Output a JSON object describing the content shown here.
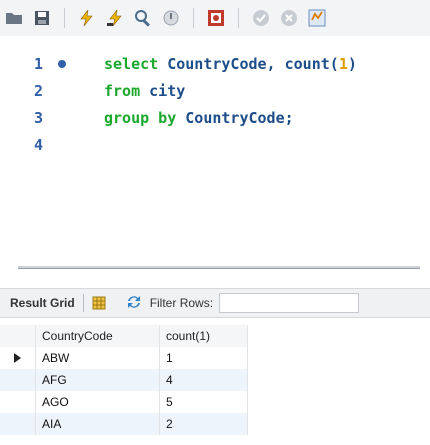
{
  "toolbar": {
    "icons": [
      "open-folder-icon",
      "save-icon",
      "execute-icon",
      "execute-current-icon",
      "explain-icon",
      "stop-icon",
      "toggle-icon",
      "commit-icon",
      "rollback-icon",
      "autocommit-icon"
    ]
  },
  "editor": {
    "lines": [
      {
        "number": "1",
        "has_marker": true,
        "tokens": [
          {
            "t": "select",
            "k": "kw"
          },
          {
            "t": " CountryCode, ",
            "k": "id"
          },
          {
            "t": "count(",
            "k": "id"
          },
          {
            "t": "1",
            "k": "num"
          },
          {
            "t": ")",
            "k": "id"
          }
        ]
      },
      {
        "number": "2",
        "has_marker": false,
        "tokens": [
          {
            "t": "from",
            "k": "kw"
          },
          {
            "t": " city",
            "k": "id"
          }
        ]
      },
      {
        "number": "3",
        "has_marker": false,
        "tokens": [
          {
            "t": "group by",
            "k": "kw"
          },
          {
            "t": " CountryCode;",
            "k": "id"
          }
        ]
      },
      {
        "number": "4",
        "has_marker": false,
        "tokens": []
      }
    ]
  },
  "result_toolbar": {
    "tab_label": "Result Grid",
    "filter_label": "Filter Rows:",
    "filter_value": ""
  },
  "grid": {
    "columns": [
      "CountryCode",
      "count(1)"
    ],
    "rows": [
      {
        "code": "ABW",
        "count": "1"
      },
      {
        "code": "AFG",
        "count": "4"
      },
      {
        "code": "AGO",
        "count": "5"
      },
      {
        "code": "AIA",
        "count": "2"
      }
    ]
  },
  "colors": {
    "keyword": "#1ca82d",
    "number": "#e09a00",
    "identifier": "#1d4e89",
    "line_number": "#2f5fa6"
  }
}
